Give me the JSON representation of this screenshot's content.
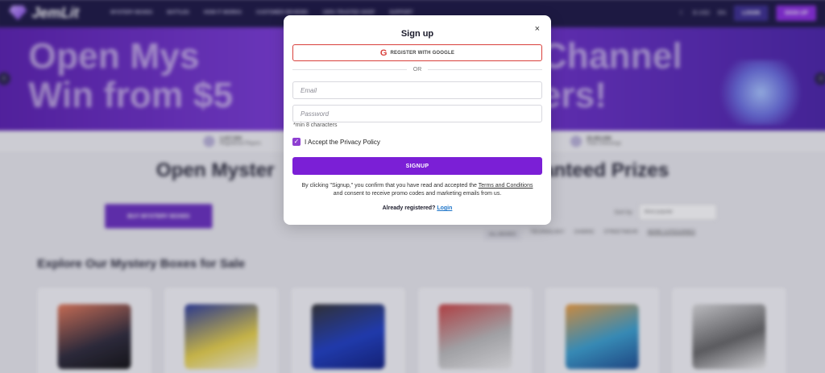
{
  "header": {
    "brand": "JemLit",
    "nav": [
      "MYSTERY BOXES",
      "BATTLES",
      "HOW IT WORKS",
      "CUSTOMER REVIEWS",
      "100% TRUSTED SHOP",
      "SUPPORT"
    ],
    "currency": "$ USD",
    "language": "EN",
    "login_label": "LOGIN",
    "signup_label": "SIGN UP"
  },
  "hero": {
    "left_text": "Open Mys\nWin from $5",
    "right_text": "Channel\ners!"
  },
  "stats": [
    {
      "value": "1,417,304",
      "label": "Registered Players"
    },
    {
      "value": "25,453,458",
      "label": "Total Unboxings"
    }
  ],
  "main": {
    "title_left": "Open Myster",
    "title_right": "anteed Prizes",
    "buy_button": "BUY MYSTERY BOXES",
    "sort_label": "Sort by",
    "sort_value": "Most popular",
    "filters": [
      "ALL BOXES",
      "TECHNOLOGY",
      "GAMING",
      "STREETWEAR",
      "MORE CATEGORIES"
    ],
    "section_title": "Explore Our Mystery Boxes for Sale"
  },
  "modal": {
    "title": "Sign up",
    "close_symbol": "×",
    "google_icon": "G",
    "google_label": "REGISTER WITH GOOGLE",
    "or_text": "OR",
    "email_placeholder": "Email",
    "password_placeholder": "Password",
    "password_hint": "*min 8 characters",
    "privacy_label": "I Accept the Privacy Policy",
    "privacy_checked": true,
    "signup_label": "SIGNUP",
    "terms_prefix": "By clicking \"Signup,\" you confirm that you have read and accepted the ",
    "terms_link": "Terms and Conditions",
    "terms_suffix": " and consent to receive promo codes and marketing emails from us.",
    "already_text": "Already registered? ",
    "login_link": "Login"
  },
  "colors": {
    "accent": "#7b1fd6",
    "google_red": "#d9403b",
    "nav_bg": "#1c1744",
    "link": "#1f76c9"
  }
}
